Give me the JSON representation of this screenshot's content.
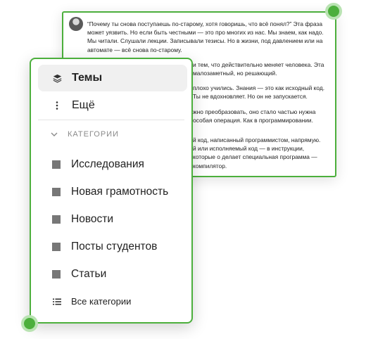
{
  "post": {
    "paragraphs": [
      "“Почему ты снова поступаешь по-старому, хотя говоришь, что всё понял?” Эта фраза может уязвить. Но если быть честными — это про многих из нас. Мы знаем, как надо. Мы читали. Слушали лекции. Записывали тезисы. Но в жизни, под давлением или на автомате — всё снова по-старому.",
      "и тем, что действительно меняет человека. Эта малозаметный, но решающий.",
      "плохо учились. Знания — это как исходный код. Ты не вдохновляет. Но он не запускается.",
      "жно преобразовать, оно стало частью нужна особая операция. Как в программировании.",
      "й код, написанный программистом, напрямую. й или исполняемый код — в инструкции, которые о делает специальная программа — компилятор."
    ]
  },
  "menu": {
    "primary": [
      {
        "label": "Темы",
        "icon": "stack-icon",
        "active": true
      },
      {
        "label": "Ещё",
        "icon": "more-vertical-icon",
        "active": false
      }
    ],
    "categories_header": "КАТЕГОРИИ",
    "categories": [
      {
        "label": "Исследования"
      },
      {
        "label": "Новая грамотность"
      },
      {
        "label": "Новости"
      },
      {
        "label": "Посты студентов"
      },
      {
        "label": "Статьи"
      }
    ],
    "all_categories_label": "Все категории"
  },
  "colors": {
    "accent": "#4caf3c",
    "accent_light": "#b9e3b2",
    "active_bg": "#f0f0f0",
    "category_square": "#777777"
  }
}
